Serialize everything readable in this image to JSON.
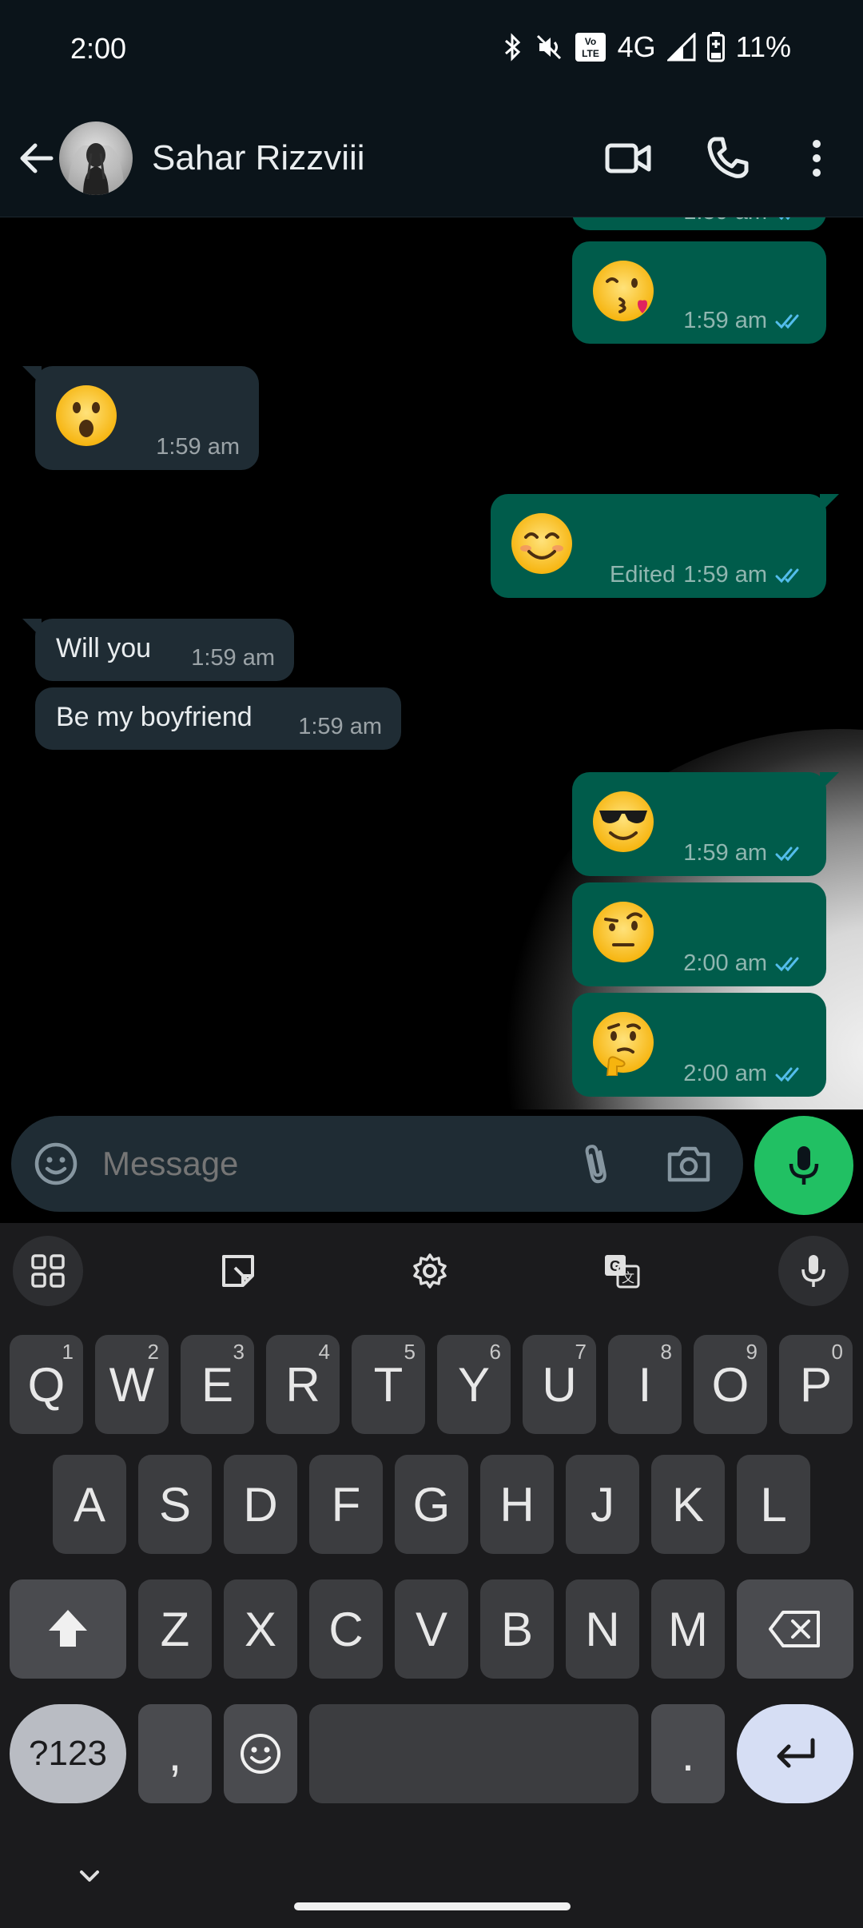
{
  "status_bar": {
    "time": "2:00",
    "network": "4G",
    "volte": "Vo LTE",
    "battery": "11%"
  },
  "header": {
    "contact_name": "Sahar Rizzviii"
  },
  "messages": [
    {
      "direction": "out",
      "emoji": "face-blowing-kiss",
      "time": "1:59 am",
      "status": "read"
    },
    {
      "direction": "in",
      "emoji": "face-with-open-mouth",
      "time": "1:59 am"
    },
    {
      "direction": "out",
      "emoji": "smiling-face-with-smiling-eyes",
      "edited_label": "Edited",
      "time": "1:59 am",
      "status": "read"
    },
    {
      "direction": "in",
      "text": "Will you",
      "time": "1:59 am"
    },
    {
      "direction": "in",
      "text": "Be my boyfriend",
      "time": "1:59 am"
    },
    {
      "direction": "out",
      "emoji": "smiling-face-with-sunglasses",
      "time": "1:59 am",
      "status": "read"
    },
    {
      "direction": "out",
      "emoji": "face-with-raised-eyebrow",
      "time": "2:00 am",
      "status": "read"
    },
    {
      "direction": "out",
      "emoji": "thinking-face",
      "time": "2:00 am",
      "status": "read"
    }
  ],
  "partial_message_time": "1:59 am",
  "input": {
    "placeholder": "Message"
  },
  "keyboard": {
    "row1": [
      {
        "letter": "Q",
        "num": "1"
      },
      {
        "letter": "W",
        "num": "2"
      },
      {
        "letter": "E",
        "num": "3"
      },
      {
        "letter": "R",
        "num": "4"
      },
      {
        "letter": "T",
        "num": "5"
      },
      {
        "letter": "Y",
        "num": "6"
      },
      {
        "letter": "U",
        "num": "7"
      },
      {
        "letter": "I",
        "num": "8"
      },
      {
        "letter": "O",
        "num": "9"
      },
      {
        "letter": "P",
        "num": "0"
      }
    ],
    "row2": [
      "A",
      "S",
      "D",
      "F",
      "G",
      "H",
      "J",
      "K",
      "L"
    ],
    "row3": [
      "Z",
      "X",
      "C",
      "V",
      "B",
      "N",
      "M"
    ],
    "symbols_label": "?123",
    "comma": ",",
    "period": "."
  },
  "colors": {
    "outgoing_bubble": "#005c4b",
    "incoming_bubble": "#1f2c34",
    "read_ticks": "#53bdeb",
    "mic_fab": "#21c063"
  },
  "icons": {
    "back": "arrow-left-icon",
    "video_call": "video-camera-icon",
    "voice_call": "phone-icon",
    "menu": "more-vertical-icon",
    "emoji": "emoji-smile-icon",
    "attach": "paperclip-icon",
    "camera": "camera-icon",
    "mic": "microphone-icon"
  }
}
